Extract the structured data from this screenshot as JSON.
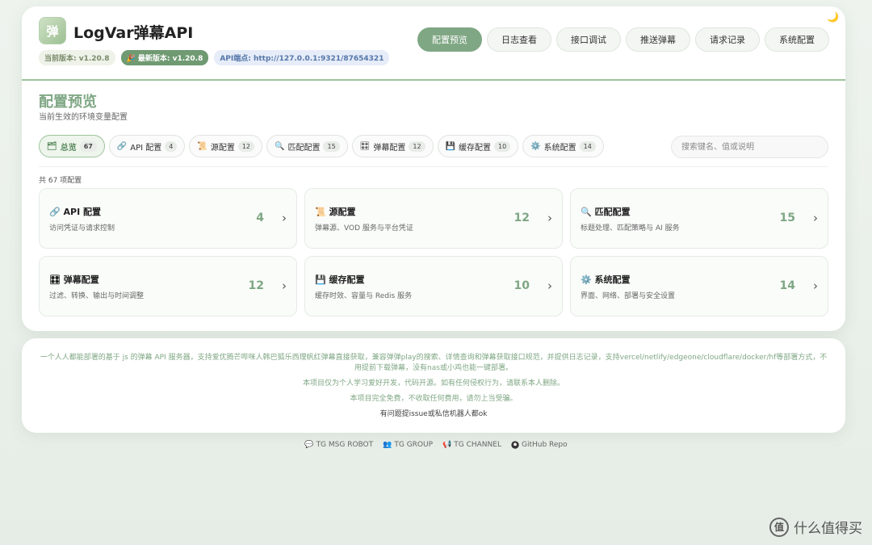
{
  "app": {
    "title": "LogVar弹幕API",
    "logo_text": "弹",
    "theme_icon": "🌙"
  },
  "badges": {
    "current": "当前版本: v1.20.8",
    "latest": "🎉 最新版本: v1.20.8",
    "endpoint": "API端点: http://127.0.0.1:9321/87654321"
  },
  "nav": [
    {
      "label": "配置预览",
      "active": true
    },
    {
      "label": "日志查看"
    },
    {
      "label": "接口调试"
    },
    {
      "label": "推送弹幕"
    },
    {
      "label": "请求记录"
    },
    {
      "label": "系统配置"
    }
  ],
  "page": {
    "title": "配置预览",
    "subtitle": "当前生效的环境变量配置",
    "search_placeholder": "搜索键名、值或说明",
    "total_text": "共 67 项配置"
  },
  "tabs": [
    {
      "icon": "🗂",
      "label": "总览",
      "count": "67"
    },
    {
      "icon": "🔗",
      "label": "API 配置",
      "count": "4"
    },
    {
      "icon": "📜",
      "label": "源配置",
      "count": "12"
    },
    {
      "icon": "🔍",
      "label": "匹配配置",
      "count": "15"
    },
    {
      "icon": "🎛",
      "label": "弹幕配置",
      "count": "12"
    },
    {
      "icon": "💾",
      "label": "缓存配置",
      "count": "10"
    },
    {
      "icon": "⚙️",
      "label": "系统配置",
      "count": "14"
    }
  ],
  "cards": [
    {
      "title": "🔗 API 配置",
      "desc": "访问凭证与请求控制",
      "count": "4"
    },
    {
      "title": "📜 源配置",
      "desc": "弹幕源、VOD 服务与平台凭证",
      "count": "12"
    },
    {
      "title": "🔍 匹配配置",
      "desc": "标题处理、匹配策略与 AI 服务",
      "count": "15"
    },
    {
      "title": "🎛 弹幕配置",
      "desc": "过滤、转换、输出与时间调整",
      "count": "12"
    },
    {
      "title": "💾 缓存配置",
      "desc": "缓存时效、容量与 Redis 服务",
      "count": "10"
    },
    {
      "title": "⚙️ 系统配置",
      "desc": "界面、网络、部署与安全设置",
      "count": "14"
    }
  ],
  "footer": {
    "line1": "一个人人都能部署的基于 js 的弹幕 API 服务器，支持爱优腾芒哔咪人韩巴狐乐西理帆红弹幕直接获取，兼容弹弹play的搜索、详情查询和弹幕获取接口规范，并提供日志记录，支持vercel/netlify/edgeone/cloudflare/docker/hf等部署方式，不用提前下载弹幕，没有nas或小鸡也能一键部署。",
    "line2": "本项目仅为个人学习爱好开发，代码开源。如有任何侵权行为，请联系本人删除。",
    "line3": "本项目完全免费，不收取任何费用，请勿上当受骗。",
    "line4": "有问题提issue或私信机器人都ok"
  },
  "links": [
    {
      "icon": "💬",
      "label": "TG MSG ROBOT"
    },
    {
      "icon": "👥",
      "label": "TG GROUP"
    },
    {
      "icon": "📢",
      "label": "TG CHANNEL"
    },
    {
      "icon": "",
      "label": "GitHub Repo"
    }
  ],
  "watermark": {
    "symbol": "值",
    "text": "什么值得买"
  },
  "colors": {
    "accent": "#7fa784",
    "accent_dark": "#5e8c62",
    "background": "#eef3ee"
  }
}
